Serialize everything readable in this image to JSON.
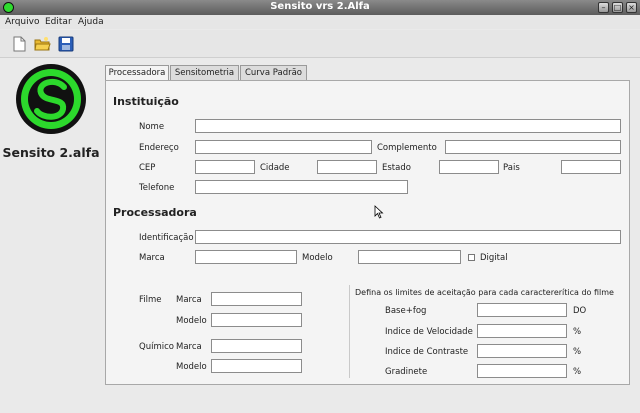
{
  "window": {
    "title": "Sensito vrs 2.Alfa"
  },
  "menu": [
    "Arquivo",
    "Editar",
    "Ajuda"
  ],
  "toolbar": {
    "icons": [
      "new-file-icon",
      "open-folder-icon",
      "save-icon"
    ]
  },
  "app": {
    "name": "Sensito 2.alfa"
  },
  "tabs": [
    "Processadora",
    "Sensitometria",
    "Curva Padrão"
  ],
  "instituicao": {
    "title": "Instituição",
    "nome": "Nome",
    "endereco": "Endereço",
    "complemento": "Complemento",
    "cep": "CEP",
    "cidade": "Cidade",
    "estado": "Estado",
    "pais": "Pais",
    "telefone": "Telefone"
  },
  "processadora": {
    "title": "Processadora",
    "identificacao": "Identificação",
    "marca": "Marca",
    "modelo": "Modelo",
    "digital": "Digital"
  },
  "filme": {
    "label": "Filme",
    "marca": "Marca",
    "modelo": "Modelo"
  },
  "quimico": {
    "label": "Químico",
    "marca": "Marca",
    "modelo": "Modelo"
  },
  "limites": {
    "heading": "Defina os limites de aceitação para cada caractererítica do filme",
    "rows": [
      {
        "label": "Base+fog",
        "unit": "DO"
      },
      {
        "label": "Indice de Velocidade",
        "unit": "%"
      },
      {
        "label": "Indice de Contraste",
        "unit": "%"
      },
      {
        "label": "Gradinete",
        "unit": "%"
      }
    ]
  }
}
